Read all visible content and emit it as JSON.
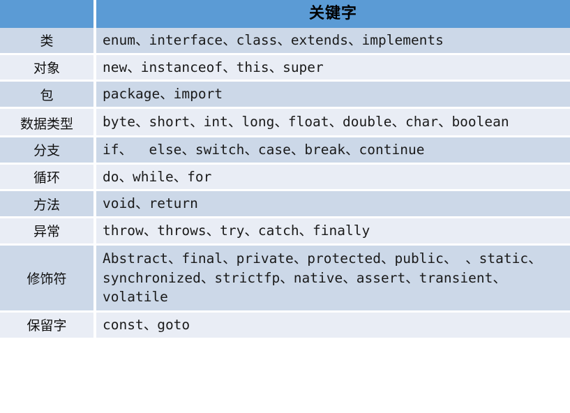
{
  "table": {
    "header": {
      "category_column_label": "",
      "keyword_column_label": "关键字"
    },
    "rows": [
      {
        "category": "类",
        "keywords": "enum、interface、class、extends、implements"
      },
      {
        "category": "对象",
        "keywords": "new、instanceof、this、super"
      },
      {
        "category": "包",
        "keywords": "package、import"
      },
      {
        "category": "数据类型",
        "keywords": "byte、short、int、long、float、double、char、boolean"
      },
      {
        "category": "分支",
        "keywords": "if、  else、switch、case、break、continue"
      },
      {
        "category": "循环",
        "keywords": "do、while、for"
      },
      {
        "category": "方法",
        "keywords": "void、return"
      },
      {
        "category": "异常",
        "keywords": "throw、throws、try、catch、finally"
      },
      {
        "category": "修饰符",
        "keywords": "Abstract、final、private、protected、public、 、static、synchronized、strictfp、native、assert、transient、volatile"
      },
      {
        "category": "保留字",
        "keywords": "const、goto"
      }
    ]
  },
  "colors": {
    "header_background": "#5b9bd5",
    "row_shade_dark": "#ccd8e8",
    "row_shade_light": "#e9edf5",
    "grid_line": "#ffffff",
    "text": "#1a1a1a"
  }
}
